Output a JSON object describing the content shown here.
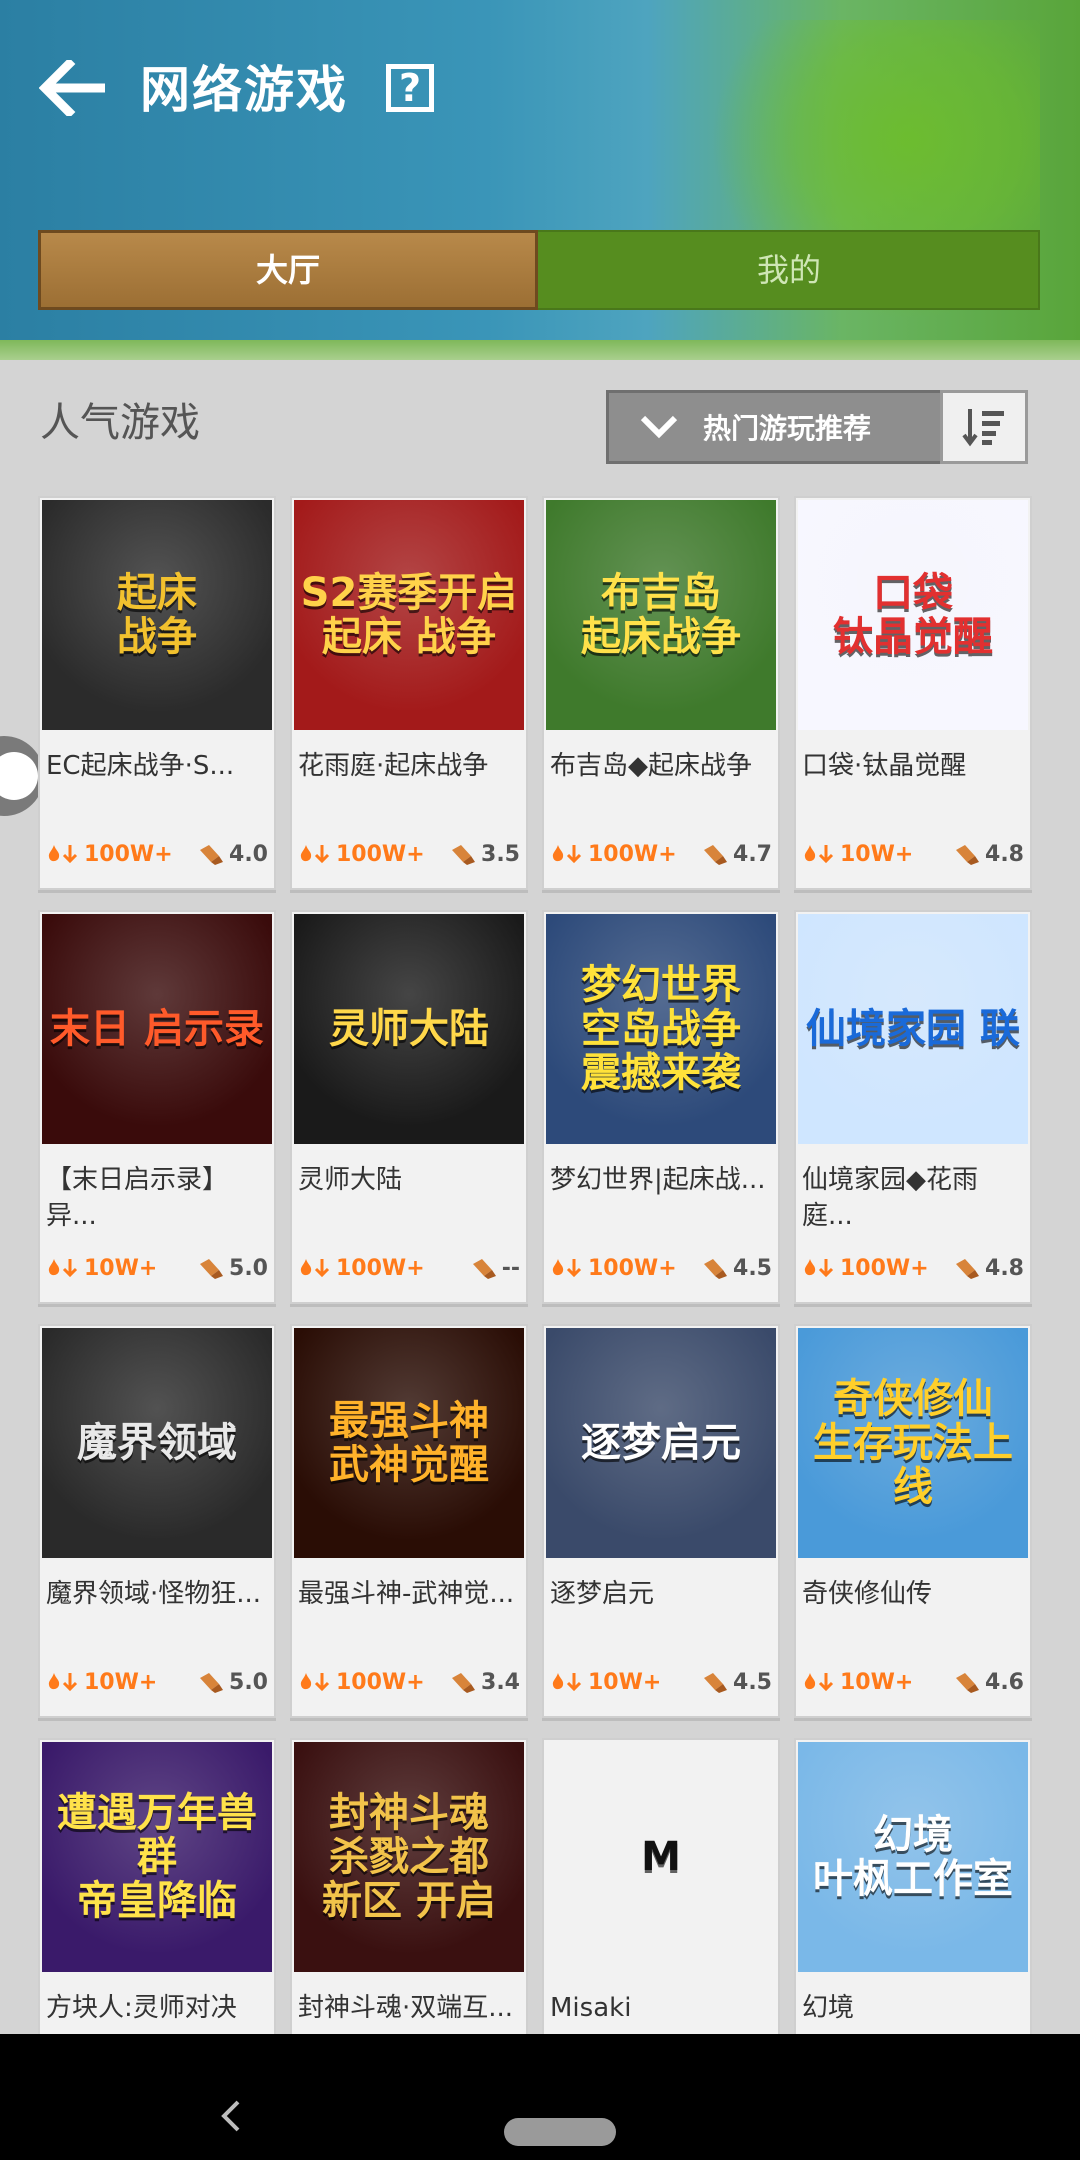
{
  "header": {
    "title": "网络游戏",
    "help_label": "?"
  },
  "tabs": [
    {
      "label": "大厅",
      "selected": true
    },
    {
      "label": "我的",
      "selected": false
    }
  ],
  "section": {
    "title": "人气游戏",
    "sort_label": "热门游玩推荐"
  },
  "games": [
    {
      "name": "EC起床战争·S...",
      "downloads": "100W+",
      "rating": "4.0",
      "thumb_text": "起床\n战争",
      "thumb_colors": [
        "#2b2b2b",
        "#f2c12e"
      ]
    },
    {
      "name": "花雨庭·起床战争",
      "downloads": "100W+",
      "rating": "3.5",
      "thumb_text": "S2赛季开启\n起床 战争",
      "thumb_colors": [
        "#a31a1a",
        "#ffd24a"
      ]
    },
    {
      "name": "布吉岛◆起床战争",
      "downloads": "100W+",
      "rating": "4.7",
      "thumb_text": "布吉岛\n起床战争",
      "thumb_colors": [
        "#3f7a2c",
        "#ffe14a"
      ]
    },
    {
      "name": "口袋·钛晶觉醒",
      "downloads": "10W+",
      "rating": "4.8",
      "thumb_text": "口袋\n钛晶觉醒",
      "thumb_colors": [
        "#f7f7ff",
        "#e23030"
      ]
    },
    {
      "name": "【末日启示录】异...",
      "downloads": "10W+",
      "rating": "5.0",
      "thumb_text": "末日 启示录",
      "thumb_colors": [
        "#3a0b0b",
        "#ff5a2a"
      ]
    },
    {
      "name": "灵师大陆",
      "downloads": "100W+",
      "rating": "--",
      "thumb_text": "灵师大陆",
      "thumb_colors": [
        "#1a1a1a",
        "#ffd84a"
      ]
    },
    {
      "name": "梦幻世界|起床战...",
      "downloads": "100W+",
      "rating": "4.5",
      "thumb_text": "梦幻世界\n空岛战争\n震撼来袭",
      "thumb_colors": [
        "#2d4a7a",
        "#ffe23a"
      ]
    },
    {
      "name": "仙境家园◆花雨庭...",
      "downloads": "100W+",
      "rating": "4.8",
      "thumb_text": "仙境家园 联",
      "thumb_colors": [
        "#cfe6ff",
        "#1a6ad9"
      ]
    },
    {
      "name": "魔界领域·怪物狂...",
      "downloads": "10W+",
      "rating": "5.0",
      "thumb_text": "魔界领域",
      "thumb_colors": [
        "#2a2a2a",
        "#e8e8e8"
      ]
    },
    {
      "name": "最强斗神-武神觉...",
      "downloads": "100W+",
      "rating": "3.4",
      "thumb_text": "最强斗神\n武神觉醒",
      "thumb_colors": [
        "#2a0d05",
        "#ffb22a"
      ]
    },
    {
      "name": "逐梦启元",
      "downloads": "10W+",
      "rating": "4.5",
      "thumb_text": "逐梦启元",
      "thumb_colors": [
        "#3a4a6a",
        "#ffffff"
      ]
    },
    {
      "name": "奇侠修仙传",
      "downloads": "10W+",
      "rating": "4.6",
      "thumb_text": "奇侠修仙\n生存玩法上线",
      "thumb_colors": [
        "#4a9ad9",
        "#ffcf2a"
      ]
    },
    {
      "name": "方块人:灵师对决",
      "downloads": "",
      "rating": "",
      "thumb_text": "遭遇万年兽群\n帝皇降临",
      "thumb_colors": [
        "#3a1a6a",
        "#ffe24a"
      ]
    },
    {
      "name": "封神斗魂·双端互...",
      "downloads": "",
      "rating": "",
      "thumb_text": "封神斗魂\n杀戮之都\n新区 开启",
      "thumb_colors": [
        "#3a1010",
        "#f2c34a"
      ]
    },
    {
      "name": "Misaki",
      "downloads": "",
      "rating": "",
      "thumb_text": "M",
      "thumb_colors": [
        "#f2f2f2",
        "#111111"
      ]
    },
    {
      "name": "幻境",
      "downloads": "",
      "rating": "",
      "thumb_text": "幻境\n叶枫工作室",
      "thumb_colors": [
        "#7ab8e8",
        "#ffffff"
      ]
    }
  ],
  "colors": {
    "accent_orange": "#ff7a1a",
    "tab_selected": "#a77838",
    "tab_bar": "#568d1f"
  },
  "icons": {
    "back": "arrow-left-icon",
    "help": "question-box-icon",
    "dropdown": "chevron-down-icon",
    "sort": "sort-list-icon",
    "downloads": "fire-download-icon",
    "rating": "rating-icon"
  }
}
